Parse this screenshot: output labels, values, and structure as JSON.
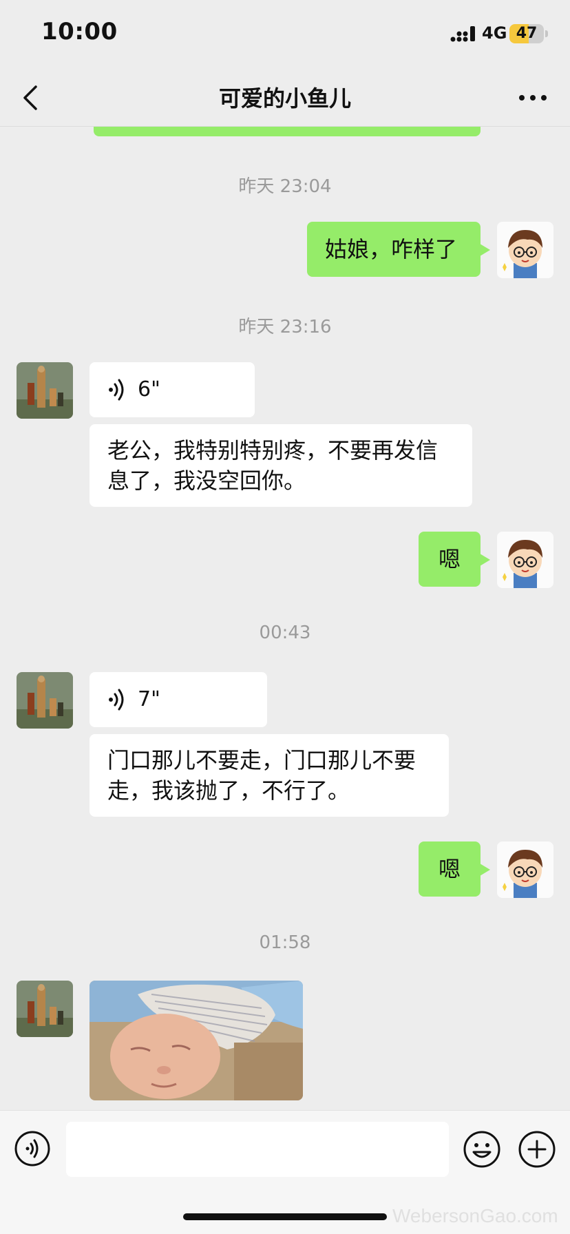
{
  "status_bar": {
    "time": "10:00",
    "network": "4G",
    "battery": "47"
  },
  "nav": {
    "title": "可爱的小鱼儿"
  },
  "messages": {
    "ts1": "昨天 23:04",
    "out1": "姑娘，咋样了",
    "ts2": "昨天 23:16",
    "voice1": "6\"",
    "in1_line1": "老公，我特别特别疼，不要再发信",
    "in1_line2": "息了，我没空回你。",
    "out2": "嗯",
    "ts3": "00:43",
    "voice2": "7\"",
    "in2_line1": "门口那儿不要走，门口那儿不要",
    "in2_line2": "走，我该抛了，不行了。",
    "out3": "嗯",
    "ts4": "01:58"
  },
  "input": {
    "placeholder": ""
  },
  "watermark": "WebersonGao.com",
  "colors": {
    "outgoing_bubble": "#95ec69",
    "incoming_bubble": "#ffffff",
    "background": "#ededed"
  }
}
